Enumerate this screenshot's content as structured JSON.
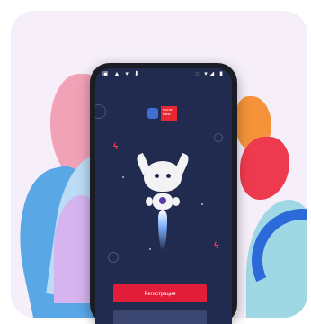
{
  "illustration": {
    "app_name_logo": "почта банк"
  },
  "phone": {
    "status_bar": {
      "left_icons": "▣ ▲ ▾ ⬇",
      "right_icons": "◌ ▾◢ ▮"
    },
    "app": {
      "register_button": "Регистрация"
    }
  }
}
